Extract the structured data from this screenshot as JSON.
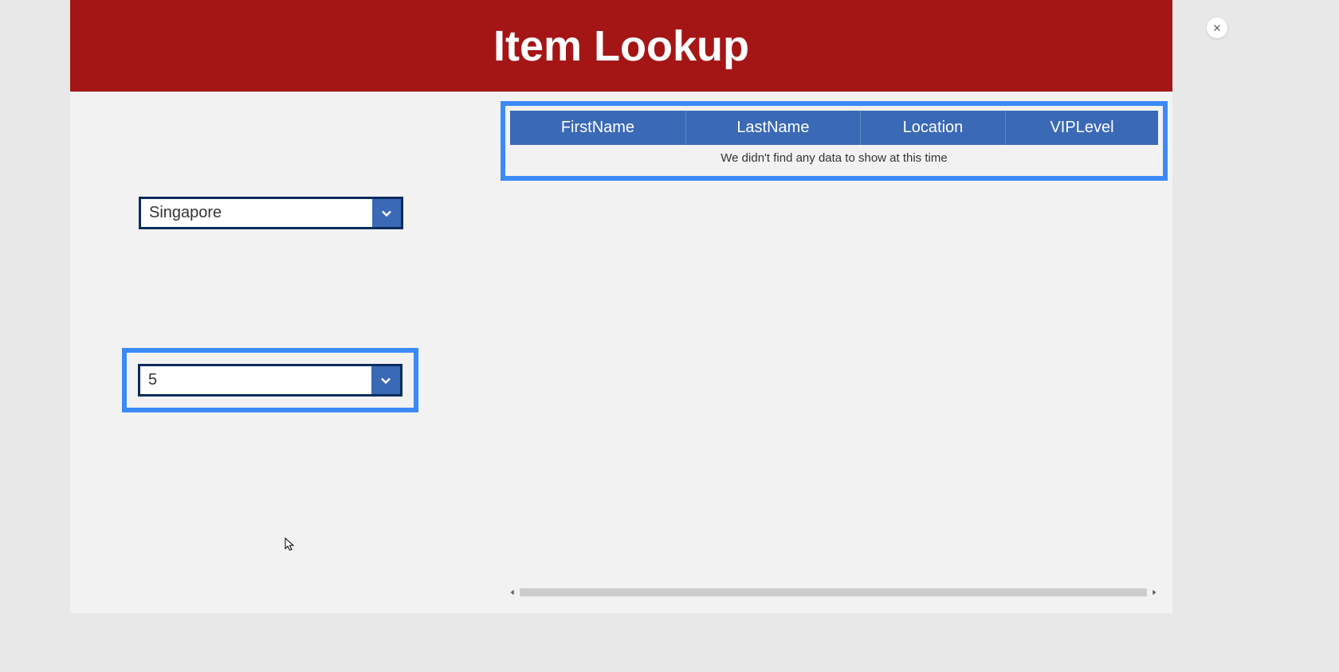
{
  "header": {
    "title": "Item Lookup"
  },
  "dropdowns": {
    "location": {
      "selected": "Singapore"
    },
    "vip": {
      "selected": "5"
    }
  },
  "table": {
    "columns": [
      "FirstName",
      "LastName",
      "Location",
      "VIPLevel"
    ],
    "empty_message": "We didn't find any data to show at this time"
  }
}
